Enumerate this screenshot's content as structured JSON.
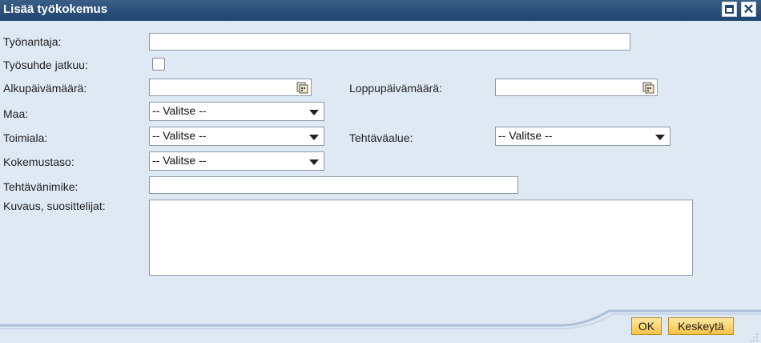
{
  "dialog": {
    "title": "Lisää työkokemus"
  },
  "form": {
    "employer_label": "Työnantaja:",
    "ongoing_label": "Työsuhde jatkuu:",
    "start_date_label": "Alkupäivämäärä:",
    "end_date_label": "Loppupäivämäärä:",
    "country_label": "Maa:",
    "country_value": "-- Valitse --",
    "industry_label": "Toimiala:",
    "industry_value": "-- Valitse --",
    "task_area_label": "Tehtäväalue:",
    "task_area_value": "-- Valitse --",
    "experience_label": "Kokemustaso:",
    "experience_value": "-- Valitse --",
    "job_title_label": "Tehtävänimike:",
    "description_label": "Kuvaus, suosittelijat:"
  },
  "buttons": {
    "ok": "OK",
    "cancel": "Keskeytä"
  },
  "colors": {
    "titlebar": "#1e4570",
    "background": "#dfe9f4",
    "button": "#f6c248"
  },
  "icons": {
    "maximize": "maximize-icon",
    "close": "close-icon",
    "calendar": "calendar-icon",
    "dropdown": "chevron-down-icon"
  }
}
